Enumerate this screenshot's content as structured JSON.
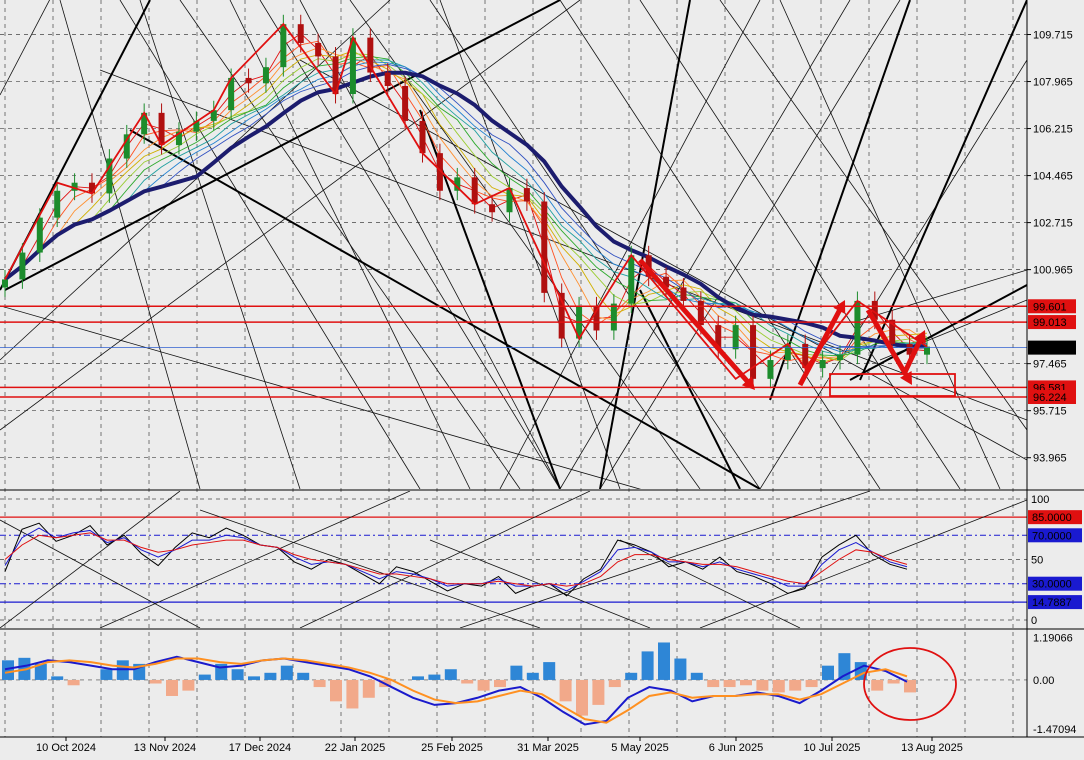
{
  "chart_data": [
    {
      "type": "line",
      "pane": "price",
      "x_ticks": [
        "10 Oct 2024",
        "13 Nov 2024",
        "17 Dec 2024",
        "22 Jan 2025",
        "25 Feb 2025",
        "31 Mar 2025",
        "5 May 2025",
        "6 Jun 2025",
        "10 Jul 2025",
        "13 Aug 2025"
      ],
      "y_ticks": [
        "109.715",
        "107.965",
        "106.215",
        "104.465",
        "102.715",
        "100.965",
        "97.465",
        "95.715",
        "93.965"
      ],
      "ylim": [
        92.8,
        111.0
      ],
      "levels": [
        {
          "label": "99.601",
          "value": 99.601,
          "color": "#e01010"
        },
        {
          "label": "99.013",
          "value": 99.013,
          "color": "#e01010"
        },
        {
          "label": "96.581",
          "value": 96.581,
          "color": "#e01010"
        },
        {
          "label": "96.224",
          "value": 96.224,
          "color": "#e01010"
        }
      ],
      "current": {
        "label": "98.062",
        "value": 98.062
      },
      "series": [
        {
          "values": [
            100.6,
            101.6,
            102.9,
            103.9,
            104.2,
            103.8,
            105.1,
            106.0,
            106.8,
            105.6,
            106.1,
            106.5,
            106.9,
            108.1,
            107.9,
            108.5,
            110.1,
            109.4,
            108.9,
            107.5,
            109.6,
            108.3,
            107.8,
            106.5,
            105.3,
            103.9,
            104.4,
            103.4,
            103.1,
            104.0,
            103.5,
            100.1,
            98.4,
            99.6,
            98.7,
            99.7,
            101.5,
            100.7,
            100.3,
            99.8,
            98.9,
            98.0,
            98.9,
            96.9,
            97.6,
            98.2,
            97.3,
            97.6,
            97.8,
            99.8,
            99.1,
            98.2,
            97.8,
            98.1
          ]
        }
      ]
    },
    {
      "type": "line",
      "pane": "oscillator",
      "y_ticks": [
        "100",
        "50",
        "0"
      ],
      "ylim": [
        0,
        100
      ],
      "levels": [
        {
          "label": "85.0000",
          "value": 85,
          "color": "#e01010"
        },
        {
          "label": "70.0000",
          "value": 70,
          "color": "#1a1ad0"
        },
        {
          "label": "30.0000",
          "value": 30,
          "color": "#1a1ad0"
        },
        {
          "label": "14.7887",
          "value": 14.7887,
          "color": "#1a1ad0"
        }
      ],
      "series": [
        {
          "values": [
            40,
            75,
            80,
            65,
            70,
            78,
            62,
            70,
            55,
            45,
            60,
            72,
            68,
            76,
            70,
            62,
            60,
            48,
            42,
            50,
            46,
            38,
            30,
            44,
            40,
            32,
            24,
            30,
            28,
            36,
            22,
            28,
            30,
            20,
            34,
            42,
            66,
            62,
            56,
            44,
            48,
            42,
            52,
            40,
            36,
            30,
            22,
            26,
            52,
            62,
            70,
            54,
            46,
            42
          ]
        },
        {
          "values": [
            45,
            68,
            76,
            68,
            72,
            74,
            64,
            68,
            58,
            52,
            58,
            66,
            66,
            70,
            68,
            62,
            60,
            52,
            46,
            48,
            46,
            40,
            34,
            40,
            38,
            34,
            28,
            30,
            30,
            34,
            28,
            28,
            30,
            24,
            32,
            40,
            58,
            60,
            56,
            48,
            48,
            44,
            48,
            42,
            38,
            34,
            28,
            28,
            46,
            58,
            64,
            56,
            48,
            44
          ]
        },
        {
          "values": [
            50,
            62,
            70,
            68,
            70,
            72,
            66,
            66,
            60,
            56,
            58,
            62,
            64,
            66,
            66,
            62,
            60,
            54,
            50,
            48,
            46,
            42,
            38,
            38,
            36,
            34,
            30,
            30,
            30,
            32,
            30,
            28,
            30,
            28,
            30,
            36,
            48,
            54,
            54,
            50,
            48,
            46,
            46,
            44,
            40,
            36,
            32,
            30,
            40,
            50,
            58,
            56,
            50,
            46
          ]
        }
      ]
    },
    {
      "type": "bar",
      "pane": "macd",
      "y_ticks": [
        "1.19066",
        "0.00",
        "-1.47094"
      ],
      "ylim": [
        -1.6,
        1.4
      ],
      "series": [
        {
          "values": [
            0.55,
            0.62,
            0.45,
            0.1,
            -0.15,
            0.0,
            0.3,
            0.55,
            0.45,
            -0.1,
            -0.45,
            -0.3,
            0.15,
            0.45,
            0.3,
            0.1,
            0.2,
            0.4,
            0.2,
            -0.2,
            -0.6,
            -0.8,
            -0.5,
            -0.2,
            0.0,
            0.1,
            0.15,
            0.3,
            -0.1,
            -0.3,
            -0.2,
            0.4,
            0.2,
            0.5,
            -0.6,
            -1.0,
            -0.7,
            -0.2,
            0.2,
            0.8,
            1.05,
            0.6,
            0.2,
            -0.2,
            -0.2,
            -0.15,
            -0.3,
            -0.35,
            -0.3,
            -0.2,
            0.4,
            0.75,
            0.5,
            -0.3,
            -0.1,
            -0.35
          ]
        },
        {
          "values": [
            0.3,
            0.4,
            0.55,
            0.5,
            0.4,
            0.3,
            0.3,
            0.5,
            0.65,
            0.5,
            0.35,
            0.4,
            0.55,
            0.6,
            0.5,
            0.4,
            0.3,
            0.1,
            -0.2,
            -0.5,
            -0.7,
            -0.65,
            -0.5,
            -0.3,
            -0.2,
            -0.5,
            -0.9,
            -1.25,
            -1.15,
            -0.5,
            -0.2,
            -0.3,
            -0.6,
            -0.45,
            -0.45,
            -0.35,
            -0.45,
            -0.65,
            -0.3,
            0.1,
            0.4,
            0.25,
            -0.05
          ]
        },
        {
          "values": [
            0.2,
            0.3,
            0.5,
            0.55,
            0.5,
            0.4,
            0.35,
            0.45,
            0.6,
            0.6,
            0.5,
            0.45,
            0.55,
            0.6,
            0.55,
            0.45,
            0.35,
            0.2,
            0.0,
            -0.3,
            -0.55,
            -0.65,
            -0.6,
            -0.45,
            -0.3,
            -0.4,
            -0.75,
            -1.1,
            -1.2,
            -0.85,
            -0.45,
            -0.35,
            -0.5,
            -0.45,
            -0.45,
            -0.4,
            -0.4,
            -0.55,
            -0.4,
            -0.1,
            0.2,
            0.3,
            0.1
          ]
        }
      ]
    }
  ]
}
